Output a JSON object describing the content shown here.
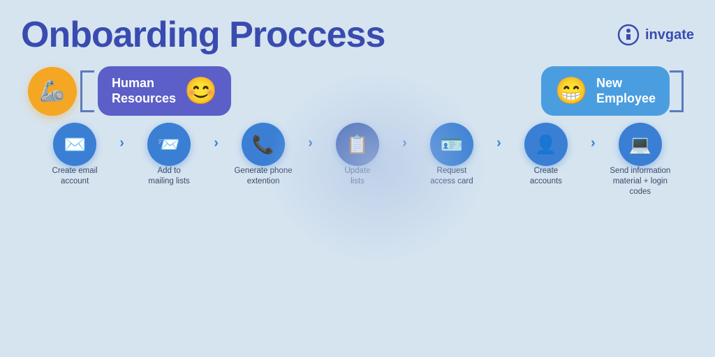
{
  "page": {
    "title": "Onboarding Proccess",
    "background_color": "#d6e4f0"
  },
  "brand": {
    "name": "invgate",
    "icon": "ℹ"
  },
  "actors": {
    "robot_emoji": "🦾",
    "hr_card": {
      "label": "Human\nResources",
      "emoji": "😊"
    },
    "new_employee_card": {
      "label": "New\nEmployee",
      "emoji": "😁"
    }
  },
  "steps": [
    {
      "id": 1,
      "icon": "✉",
      "label": "Create email\naccount",
      "dark": false
    },
    {
      "id": 2,
      "icon": "📨",
      "label": "Add to\nmailing lists",
      "dark": false
    },
    {
      "id": 3,
      "icon": "📞",
      "label": "Generate phone\nextention",
      "dark": false
    },
    {
      "id": 4,
      "icon": "📋",
      "label": "Update\nlists",
      "dark": true
    },
    {
      "id": 5,
      "icon": "🪪",
      "label": "Request\naccess card",
      "dark": false
    },
    {
      "id": 6,
      "icon": "👤",
      "label": "Create\naccounts",
      "dark": false
    },
    {
      "id": 7,
      "icon": "💻",
      "label": "Send information\nmaterial + login\ncodes",
      "dark": false
    }
  ]
}
